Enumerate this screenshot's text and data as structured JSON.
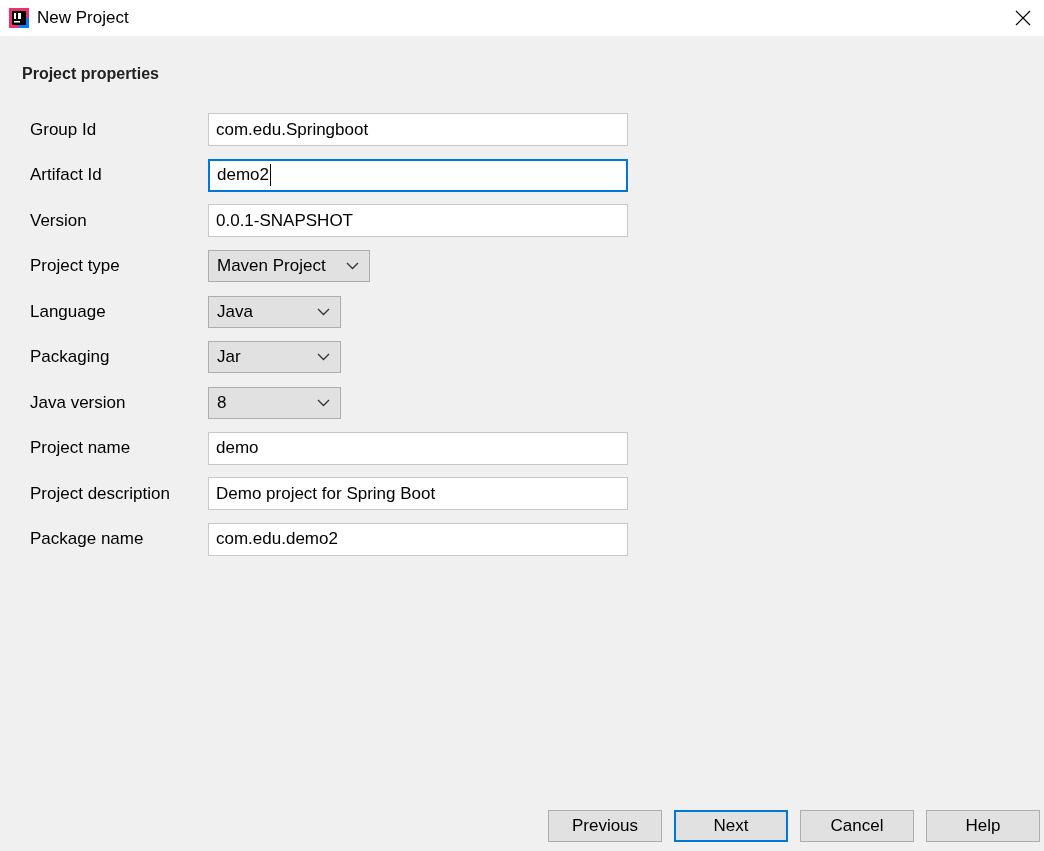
{
  "window": {
    "title": "New Project"
  },
  "section_title": "Project properties",
  "fields": [
    {
      "kind": "text",
      "label": "Group Id",
      "value": "com.edu.Springboot",
      "focused": false
    },
    {
      "kind": "text",
      "label": "Artifact Id",
      "value": "demo2",
      "focused": true
    },
    {
      "kind": "text",
      "label": "Version",
      "value": "0.0.1-SNAPSHOT",
      "focused": false
    },
    {
      "kind": "select",
      "label": "Project type",
      "value": "Maven Project",
      "focused": false
    },
    {
      "kind": "select",
      "label": "Language",
      "value": "Java",
      "focused": false
    },
    {
      "kind": "select",
      "label": "Packaging",
      "value": "Jar",
      "focused": false
    },
    {
      "kind": "select",
      "label": "Java version",
      "value": "8",
      "focused": false
    },
    {
      "kind": "text",
      "label": "Project name",
      "value": "demo",
      "focused": false
    },
    {
      "kind": "text",
      "label": "Project description",
      "value": "Demo project for Spring Boot",
      "focused": false
    },
    {
      "kind": "text",
      "label": "Package name",
      "value": "com.edu.demo2",
      "focused": false
    }
  ],
  "buttons": [
    {
      "label": "Previous",
      "default": false
    },
    {
      "label": "Next",
      "default": true
    },
    {
      "label": "Cancel",
      "default": false
    },
    {
      "label": "Help",
      "default": false
    }
  ]
}
